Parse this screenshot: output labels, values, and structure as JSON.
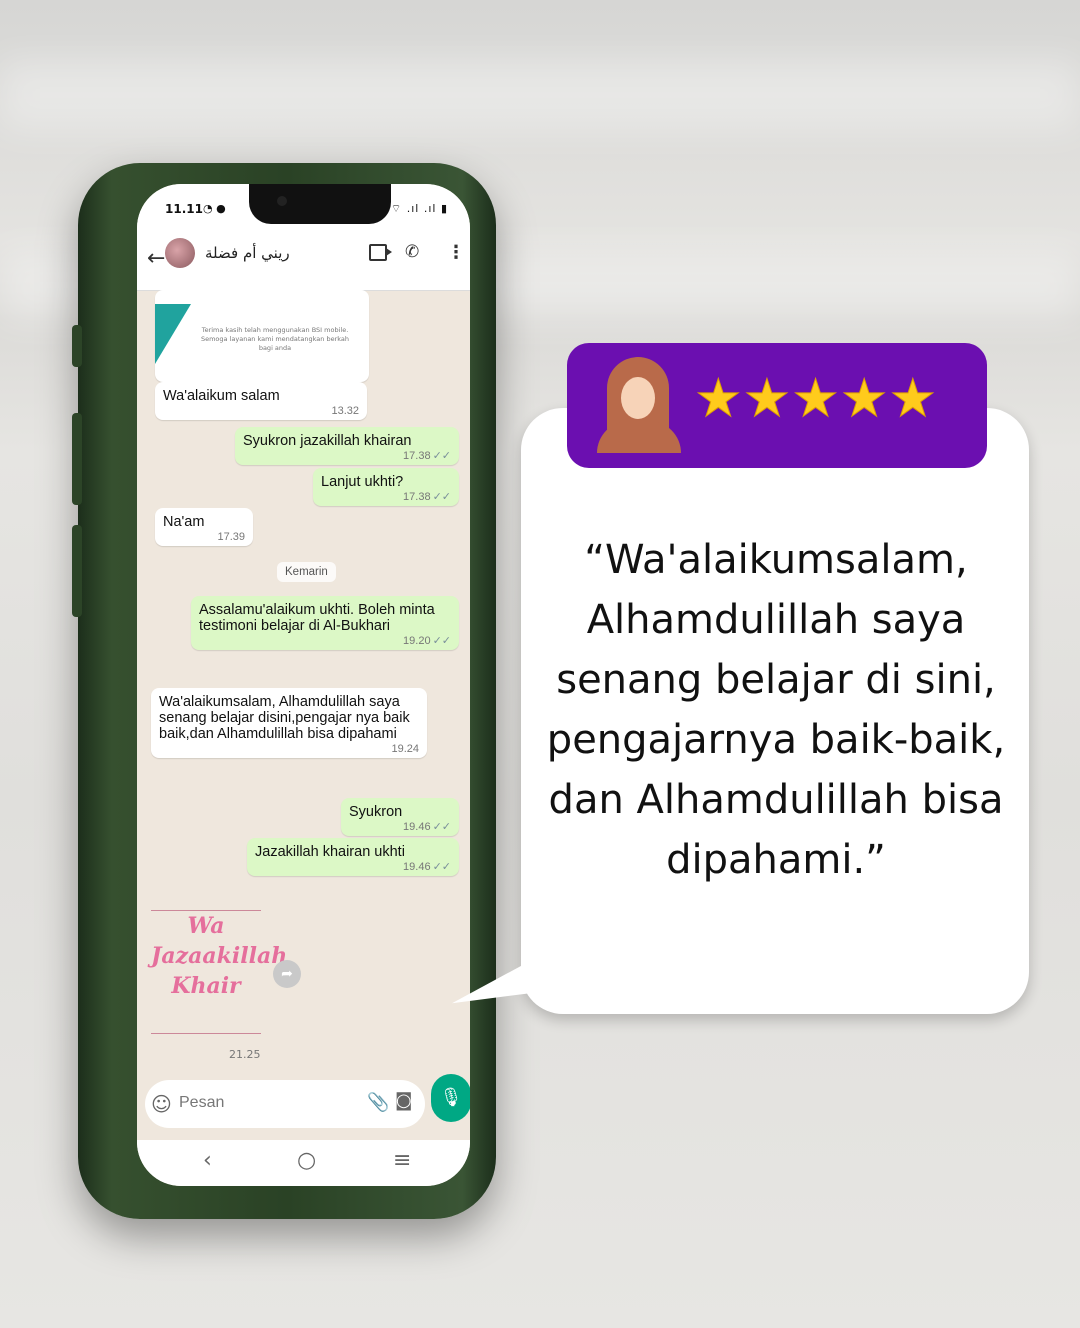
{
  "phone": {
    "status_time": "11.11",
    "contact_name": "ريني أم فضلة",
    "icons": [
      "back-arrow-icon",
      "video-call-icon",
      "phone-call-icon",
      "more-options-icon"
    ],
    "receipt_text": "Terima kasih telah menggunakan BSI mobile. Semoga layanan kami mendatangkan berkah bagi anda",
    "messages": [
      {
        "direction": "in",
        "text": "Wa'alaikum salam",
        "time": "13.32"
      },
      {
        "direction": "out",
        "text": "Syukron jazakillah khairan",
        "time": "17.38"
      },
      {
        "direction": "out",
        "text": "Lanjut ukhti?",
        "time": "17.38"
      },
      {
        "direction": "in",
        "text": "Na'am",
        "time": "17.39"
      },
      {
        "direction": "out",
        "text": "Assalamu'alaikum ukhti. Boleh minta testimoni belajar di Al-Bukhari",
        "time": "19.20"
      },
      {
        "direction": "in",
        "text": "Wa'alaikumsalam, Alhamdulillah saya senang belajar disini,pengajar nya baik baik,dan Alhamdulillah bisa dipahami",
        "time": "19.24"
      },
      {
        "direction": "out",
        "text": "Syukron",
        "time": "19.46"
      },
      {
        "direction": "out",
        "text": "Jazakillah khairan ukhti",
        "time": "19.46"
      }
    ],
    "date_separator": "Kemarin",
    "sticker_text": "Wa Jazaakillah Khair",
    "sticker_time": "21.25",
    "input_placeholder": "Pesan"
  },
  "testimonial": {
    "stars": "★★★★★",
    "rating": 5,
    "accent_color": "#6b0fb0",
    "star_color": "#ffcb1c",
    "quote": "“Wa'alaikumsalam, Alhamdulillah saya senang belajar di sini, pengajarnya baik-baik, dan Alhamdulillah bisa dipahami.”"
  }
}
